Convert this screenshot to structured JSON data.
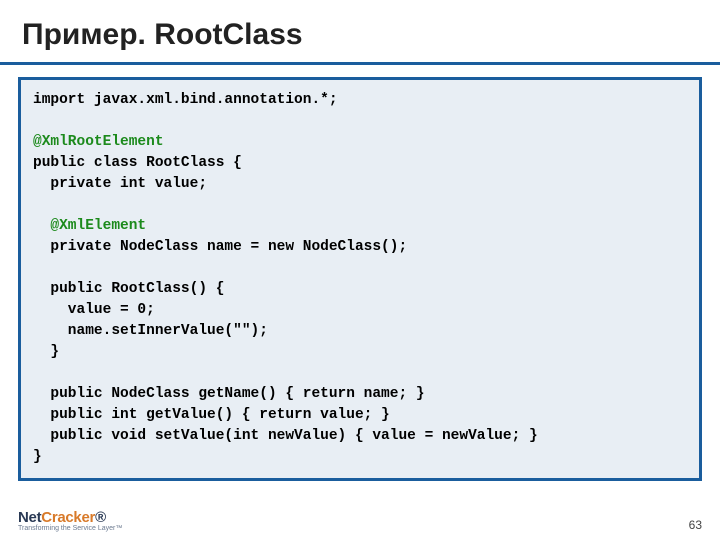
{
  "title": "Пример. RootClass",
  "code": {
    "l01": "import javax.xml.bind.annotation.*;",
    "l02": "",
    "l03": "@XmlRootElement",
    "l04": "public class RootClass {",
    "l05": "  private int value;",
    "l06": "",
    "l07": "  @XmlElement",
    "l08": "  private NodeClass name = new NodeClass();",
    "l09": "",
    "l10": "  public RootClass() {",
    "l11": "    value = 0;",
    "l12": "    name.setInnerValue(\"\");",
    "l13": "  }",
    "l14": "",
    "l15": "  public NodeClass getName() { return name; }",
    "l16": "  public int getValue() { return value; }",
    "l17": "  public void setValue(int newValue) { value = newValue; }",
    "l18": "}"
  },
  "footer": {
    "logo_part1": "Net",
    "logo_part2": "Cracker",
    "logo_r": "®",
    "tagline": "Transforming the Service Layer™",
    "page": "63"
  }
}
